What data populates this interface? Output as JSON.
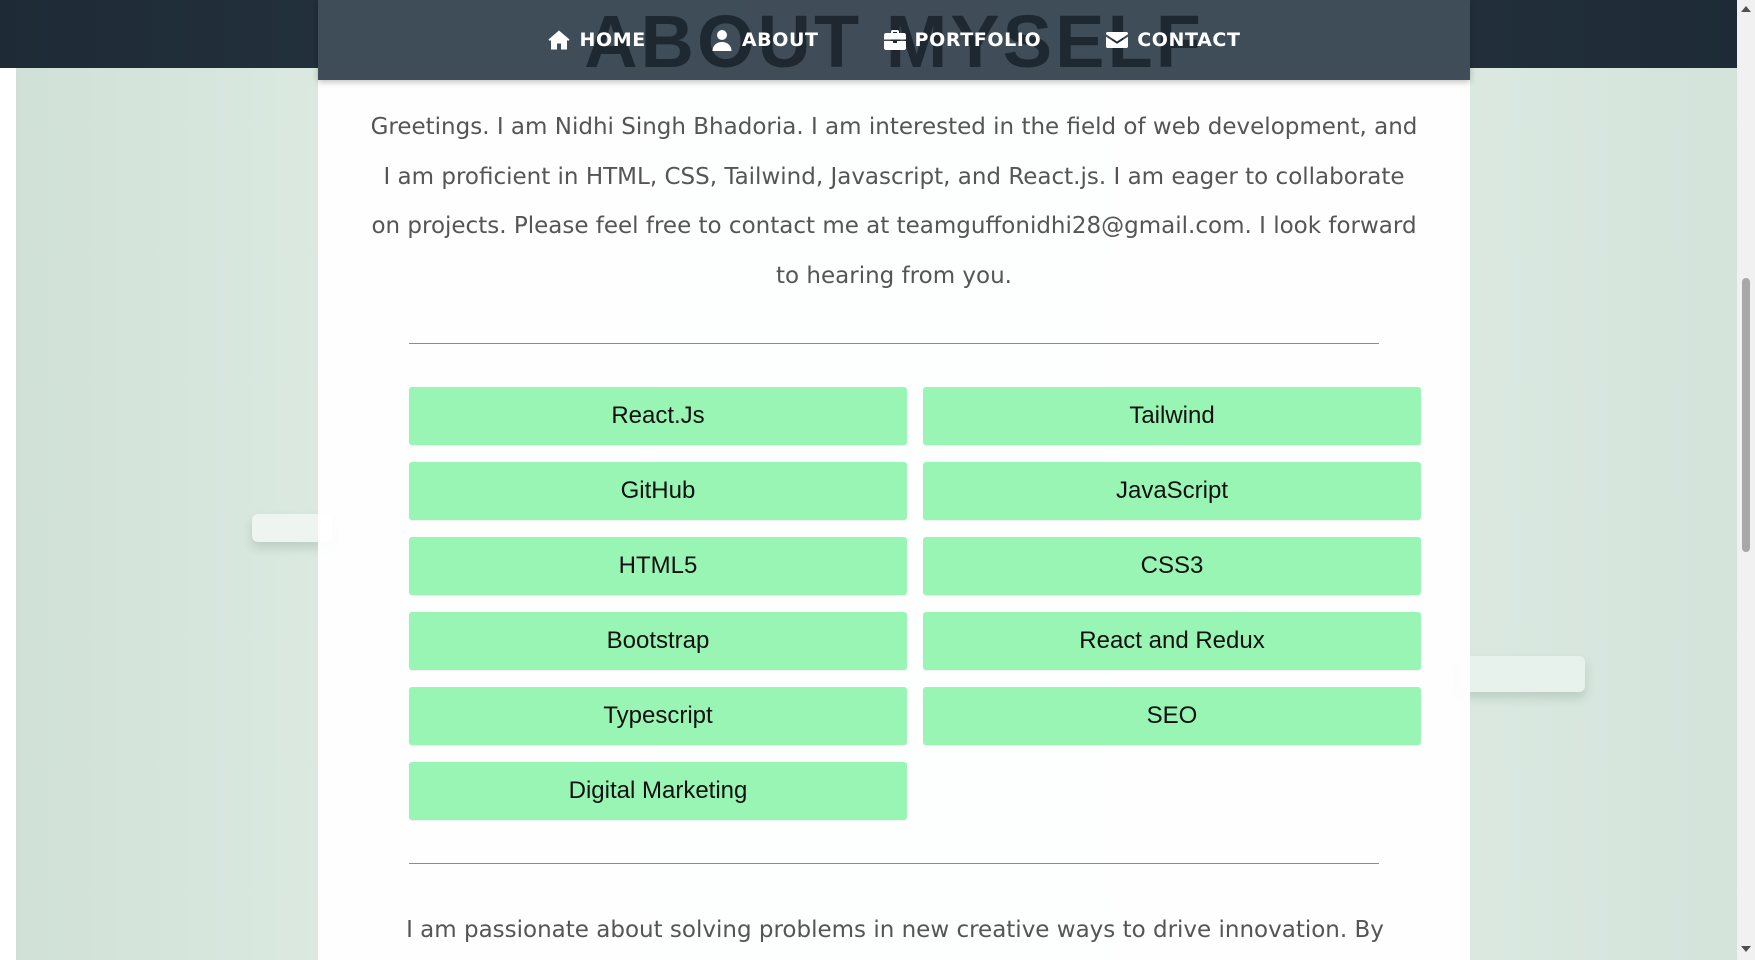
{
  "page": {
    "heading": "ABOUT MYSELF"
  },
  "nav": {
    "items": [
      {
        "label": "HOME",
        "icon": "home-icon"
      },
      {
        "label": "ABOUT",
        "icon": "user-icon"
      },
      {
        "label": "PORTFOLIO",
        "icon": "briefcase-icon"
      },
      {
        "label": "CONTACT",
        "icon": "envelope-icon"
      }
    ]
  },
  "intro": {
    "text": "Greetings. I am Nidhi Singh Bhadoria. I am interested in the field of web development, and I am proficient in HTML, CSS, Tailwind, Javascript, and React.js. I am eager to collaborate on projects. Please feel free to contact me at teamguffonidhi28@gmail.com. I look forward to hearing from you."
  },
  "skills": [
    "React.Js",
    "Tailwind",
    "GitHub",
    "JavaScript",
    "HTML5",
    "CSS3",
    "Bootstrap",
    "React and Redux",
    "Typescript",
    "SEO",
    "Digital Marketing"
  ],
  "outro": {
    "text": "I am passionate about solving problems in new creative ways to drive innovation. By"
  },
  "colors": {
    "skill_bg": "#98f5b4",
    "navbar_bg": "#34424f",
    "page_bg": "#dceae2",
    "body_text": "#555555"
  }
}
